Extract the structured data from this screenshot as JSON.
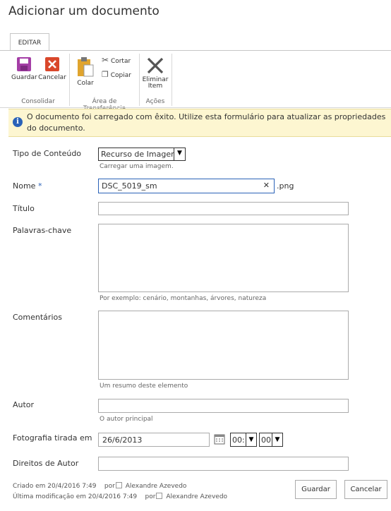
{
  "page": {
    "title": "Adicionar um documento"
  },
  "ribbon": {
    "tab": "EDITAR",
    "groups": {
      "consolidar": "Consolidar",
      "clipboard": "Área de Transferência",
      "acoes": "Ações"
    },
    "buttons": {
      "guardar": "Guardar",
      "cancelar": "Cancelar",
      "colar": "Colar",
      "cortar": "Cortar",
      "copiar": "Copiar",
      "eliminar_line1": "Eliminar",
      "eliminar_line2": "Item"
    }
  },
  "message": "O documento foi carregado com êxito. Utilize esta formulário para atualizar as propriedades do documento.",
  "form": {
    "content_type": {
      "label": "Tipo de Conteúdo",
      "value": "Recurso de Imagem",
      "hint": "Carregar uma imagem."
    },
    "name": {
      "label": "Nome",
      "required_mark": "*",
      "value": "DSC_5019_sm",
      "extension": ".png",
      "clear": "✕"
    },
    "title": {
      "label": "Título",
      "value": ""
    },
    "keywords": {
      "label": "Palavras-chave",
      "value": "",
      "hint": "Por exemplo: cenário, montanhas, árvores, natureza"
    },
    "comments": {
      "label": "Comentários",
      "value": "",
      "hint": "Um resumo deste elemento"
    },
    "author": {
      "label": "Autor",
      "value": "",
      "hint": "O autor principal"
    },
    "photo_date": {
      "label": "Fotografia tirada em",
      "date": "26/6/2013",
      "hour": "00:",
      "minute": "00"
    },
    "rights": {
      "label": "Direitos de Autor",
      "value": ""
    }
  },
  "footer": {
    "created": "Criado em 20/4/2016 7:49",
    "created_by_prefix": "por",
    "created_by": "Alexandre Azevedo",
    "modified": "Última modificação em 20/4/2016 7:49",
    "modified_by_prefix": "por",
    "modified_by": "Alexandre Azevedo",
    "save": "Guardar",
    "cancel": "Cancelar"
  },
  "colors": {
    "accent": "#2a62b8",
    "message_bg": "#fdf6d1",
    "save_icon": "#a43ea6",
    "cancel_icon": "#d9472b"
  }
}
